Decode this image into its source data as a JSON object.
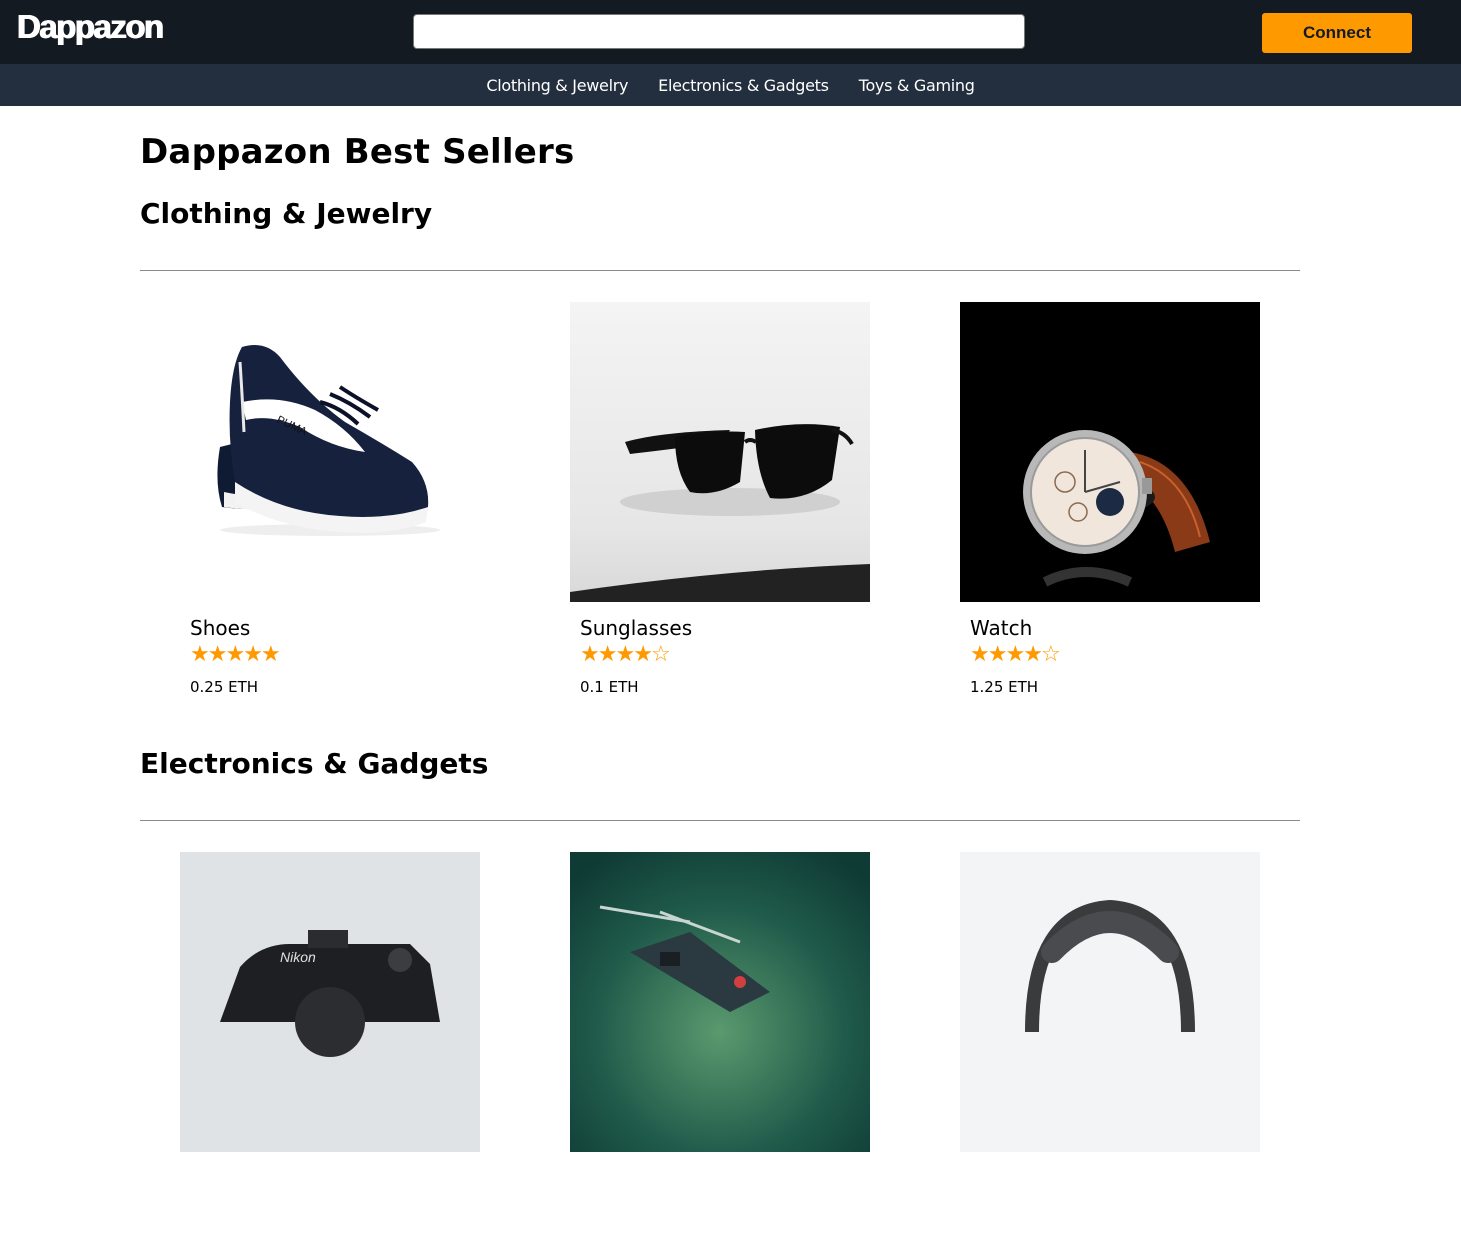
{
  "header": {
    "logo": "Dappazon",
    "search_placeholder": "",
    "connect_label": "Connect"
  },
  "nav": {
    "items": [
      "Clothing & Jewelry",
      "Electronics & Gadgets",
      "Toys & Gaming"
    ]
  },
  "page_title": "Dappazon Best Sellers",
  "sections": [
    {
      "title": "Clothing & Jewelry",
      "products": [
        {
          "name": "Shoes",
          "rating": 5,
          "max_rating": 5,
          "price": "0.25 ETH",
          "image": "shoe-image"
        },
        {
          "name": "Sunglasses",
          "rating": 4,
          "max_rating": 5,
          "price": "0.1 ETH",
          "image": "sunglasses-image"
        },
        {
          "name": "Watch",
          "rating": 4,
          "max_rating": 5,
          "price": "1.25 ETH",
          "image": "watch-image"
        }
      ]
    },
    {
      "title": "Electronics & Gadgets",
      "products": [
        {
          "image": "camera-image"
        },
        {
          "image": "drone-image"
        },
        {
          "image": "headset-image"
        }
      ]
    }
  ],
  "colors": {
    "topbar": "#131a22",
    "navbar": "#232f3e",
    "accent": "#ff9900"
  }
}
